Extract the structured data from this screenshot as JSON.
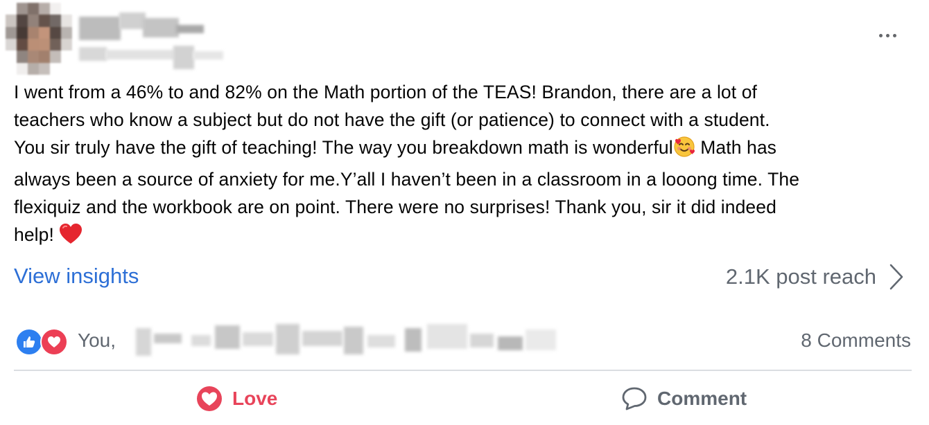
{
  "post": {
    "body_lines": [
      "I went from a 46% to and 82% on the Math portion of the TEAS! Brandon, there are a lot of",
      "teachers who know a subject but do not have the gift (or patience) to connect with a student.",
      "You  sir truly have the gift of teaching! The way you breakdown math is wonderful",
      " Math has",
      "always been a source of anxiety for me.Y’all I haven’t been in a classroom in a looong time. The",
      "flexiquiz and the workbook are on point. There were no surprises! Thank you, sir it did indeed",
      "help! "
    ]
  },
  "insights": {
    "label": "View insights",
    "reach": "2.1K post reach"
  },
  "reactions": {
    "reactors_prefix": "You,",
    "comments": "8 Comments"
  },
  "actions": {
    "love": "Love",
    "comment": "Comment"
  },
  "icons": {
    "more": "more-options-icon",
    "chevron": "chevron-right-icon",
    "like": "like-reaction-icon",
    "love": "love-reaction-icon",
    "emoji_smile_hearts": "smiling-face-with-hearts-emoji",
    "emoji_heart": "red-heart-emoji",
    "comment": "comment-bubble-icon"
  },
  "colors": {
    "link_blue": "#2d6fd6",
    "love_red": "#e8445a",
    "like_blue": "#2d7ff0",
    "muted_gray": "#606770"
  }
}
